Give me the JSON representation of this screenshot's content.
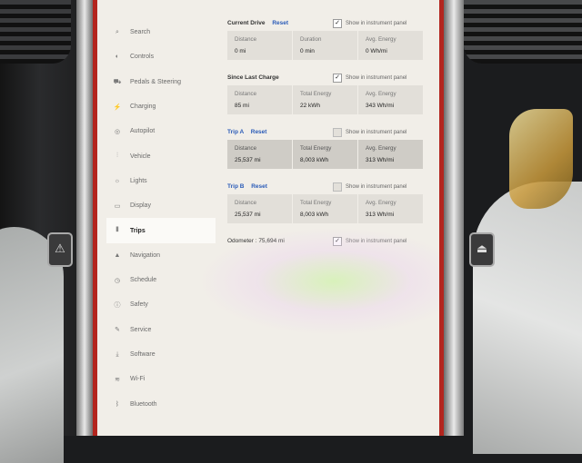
{
  "side_tag": "RED/ORANGE",
  "sidebar": {
    "items": [
      {
        "label": "Search",
        "icon": "search-icon",
        "glyph": "⌕"
      },
      {
        "label": "Controls",
        "icon": "toggle-icon",
        "glyph": "◐"
      },
      {
        "label": "Pedals & Steering",
        "icon": "car-icon",
        "glyph": "⛟"
      },
      {
        "label": "Charging",
        "icon": "bolt-icon",
        "glyph": "⚡"
      },
      {
        "label": "Autopilot",
        "icon": "steering-wheel-icon",
        "glyph": "◎"
      },
      {
        "label": "Vehicle",
        "icon": "sliders-icon",
        "glyph": "⫶"
      },
      {
        "label": "Lights",
        "icon": "sun-icon",
        "glyph": "☼"
      },
      {
        "label": "Display",
        "icon": "display-icon",
        "glyph": "▭"
      },
      {
        "label": "Trips",
        "icon": "trips-icon",
        "glyph": "⫴"
      },
      {
        "label": "Navigation",
        "icon": "navigation-arrow-icon",
        "glyph": "▲"
      },
      {
        "label": "Schedule",
        "icon": "clock-icon",
        "glyph": "◷"
      },
      {
        "label": "Safety",
        "icon": "info-circle-icon",
        "glyph": "ⓘ"
      },
      {
        "label": "Service",
        "icon": "wrench-icon",
        "glyph": "✎"
      },
      {
        "label": "Software",
        "icon": "download-icon",
        "glyph": "⤓"
      },
      {
        "label": "Wi-Fi",
        "icon": "wifi-icon",
        "glyph": "≋"
      },
      {
        "label": "Bluetooth",
        "icon": "bluetooth-icon",
        "glyph": "ᛒ"
      }
    ],
    "active_index": 8
  },
  "current_drive": {
    "title": "Current Drive",
    "reset": "Reset",
    "show_label": "Show in instrument panel",
    "show_checked": true,
    "stats": [
      {
        "label": "Distance",
        "value": "0 mi"
      },
      {
        "label": "Duration",
        "value": "0 min"
      },
      {
        "label": "Avg. Energy",
        "value": "0 Wh/mi"
      }
    ]
  },
  "since_last_charge": {
    "title": "Since Last Charge",
    "show_label": "Show in instrument panel",
    "show_checked": true,
    "stats": [
      {
        "label": "Distance",
        "value": "85 mi"
      },
      {
        "label": "Total Energy",
        "value": "22 kWh"
      },
      {
        "label": "Avg. Energy",
        "value": "343 Wh/mi"
      }
    ]
  },
  "trip_a": {
    "title": "Trip A",
    "reset": "Reset",
    "show_label": "Show in instrument panel",
    "show_checked": false,
    "stats": [
      {
        "label": "Distance",
        "value": "25,537 mi"
      },
      {
        "label": "Total Energy",
        "value": "8,003 kWh"
      },
      {
        "label": "Avg. Energy",
        "value": "313 Wh/mi"
      }
    ]
  },
  "trip_b": {
    "title": "Trip B",
    "reset": "Reset",
    "show_label": "Show in instrument panel",
    "show_checked": false,
    "stats": [
      {
        "label": "Distance",
        "value": "25,537 mi"
      },
      {
        "label": "Total Energy",
        "value": "8,003 kWh"
      },
      {
        "label": "Avg. Energy",
        "value": "313 Wh/mi"
      }
    ]
  },
  "odometer": {
    "label": "Odometer :  75,694 mi",
    "show_label": "Show in instrument panel",
    "show_checked": true
  },
  "check_glyph": "✓",
  "colors": {
    "accent": "#2a5bb8",
    "bezel": "#b3251e"
  }
}
